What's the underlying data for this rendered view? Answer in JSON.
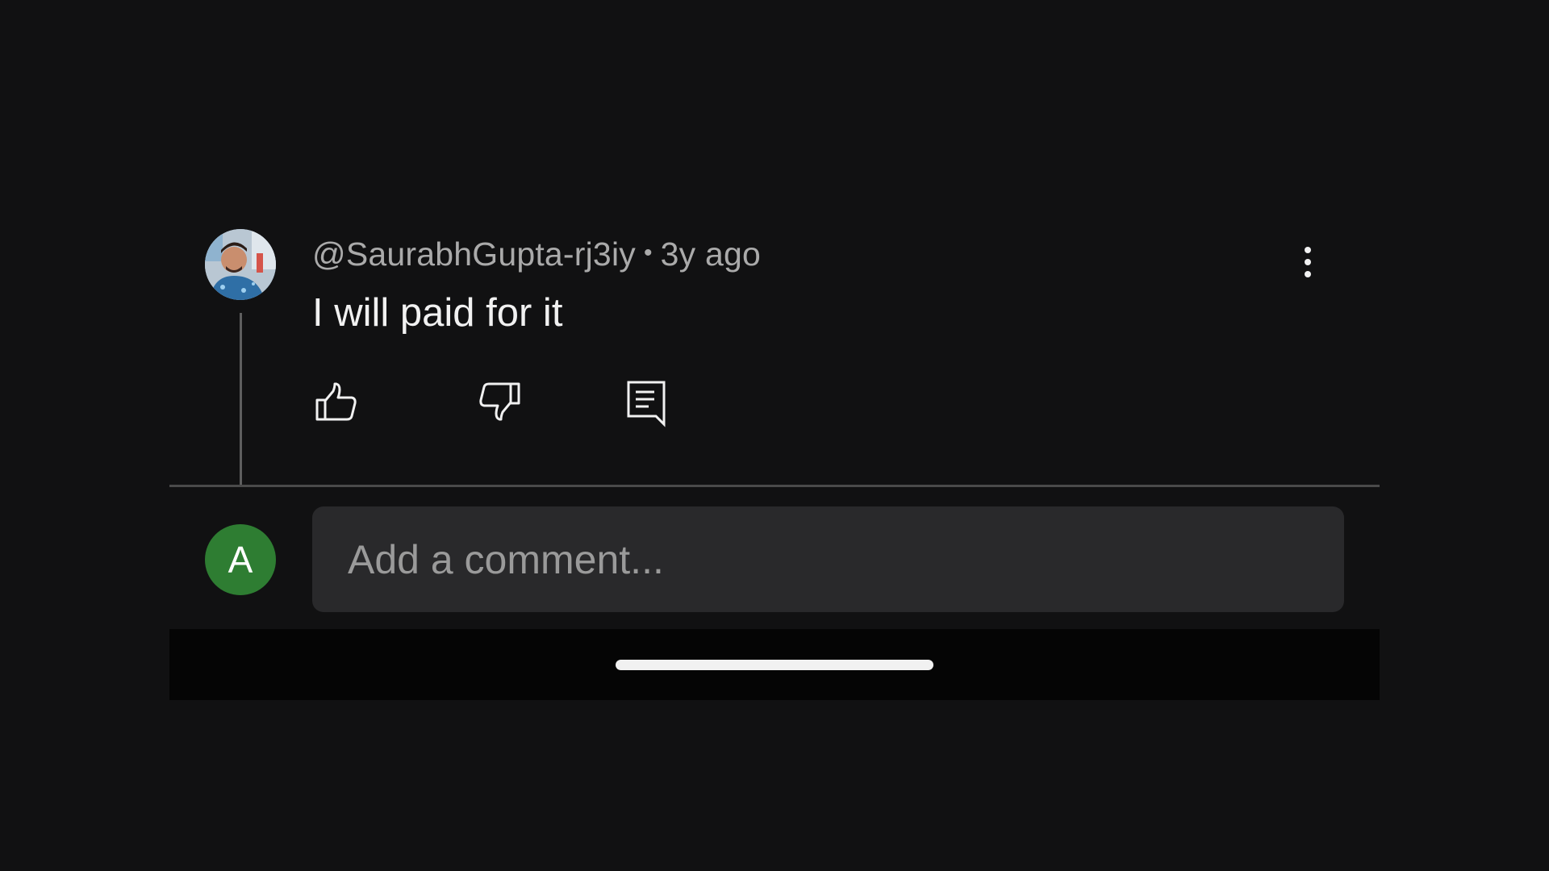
{
  "comment": {
    "author": "@SaurabhGupta-rj3iy",
    "separator": "•",
    "time": "3y ago",
    "text": "I will paid for it"
  },
  "actions": {
    "like_icon": "thumbs-up-icon",
    "dislike_icon": "thumbs-down-icon",
    "reply_icon": "reply-comment-icon",
    "more_icon": "more-vertical-icon"
  },
  "composer": {
    "avatar_letter": "A",
    "placeholder": "Add a comment..."
  },
  "colors": {
    "background": "#111112",
    "avatar_green": "#2e7d32",
    "input_background": "#29292b",
    "divider": "#4a4a4a"
  }
}
